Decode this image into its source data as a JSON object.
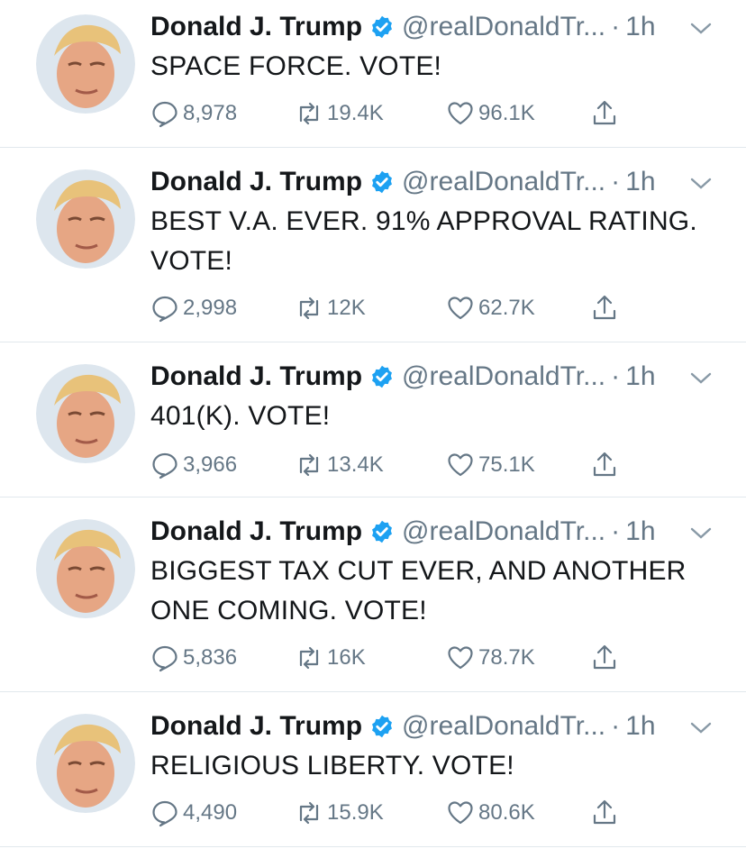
{
  "colors": {
    "text": "#14171a",
    "secondary": "#657786",
    "verified": "#1da1f2",
    "divider": "#e1e8ed"
  },
  "icons": {
    "reply": "speech-bubble-icon",
    "retweet": "retweet-icon",
    "like": "heart-icon",
    "share": "share-icon",
    "verified": "verified-badge-icon",
    "menu": "chevron-down-icon"
  },
  "tweets": [
    {
      "name": "Donald J. Trump",
      "handle": "@realDonaldTr...",
      "dot": "·",
      "time": "1h",
      "text": "SPACE FORCE. VOTE!",
      "replies": "8,978",
      "retweets": "19.4K",
      "likes": "96.1K"
    },
    {
      "name": "Donald J. Trump",
      "handle": "@realDonaldTr...",
      "dot": "·",
      "time": "1h",
      "text": "BEST V.A. EVER. 91% APPROVAL RATING.\nVOTE!",
      "replies": "2,998",
      "retweets": "12K",
      "likes": "62.7K"
    },
    {
      "name": "Donald J. Trump",
      "handle": "@realDonaldTr...",
      "dot": "·",
      "time": "1h",
      "text": "401(K). VOTE!",
      "replies": "3,966",
      "retweets": "13.4K",
      "likes": "75.1K"
    },
    {
      "name": "Donald J. Trump",
      "handle": "@realDonaldTr...",
      "dot": "·",
      "time": "1h",
      "text": "BIGGEST TAX CUT EVER, AND ANOTHER\nONE COMING. VOTE!",
      "replies": "5,836",
      "retweets": "16K",
      "likes": "78.7K"
    },
    {
      "name": "Donald J. Trump",
      "handle": "@realDonaldTr...",
      "dot": "·",
      "time": "1h",
      "text": "RELIGIOUS LIBERTY. VOTE!",
      "replies": "4,490",
      "retweets": "15.9K",
      "likes": "80.6K"
    }
  ]
}
